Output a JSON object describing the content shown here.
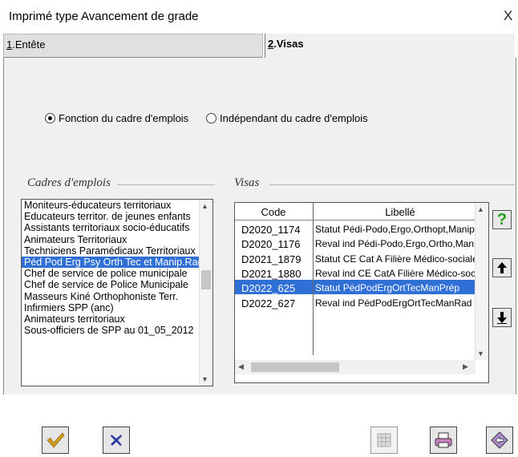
{
  "window": {
    "title": "Imprimé type Avancement de grade",
    "close_glyph": "X"
  },
  "tabs": [
    {
      "mnemonic": "1",
      "label": ".Entête"
    },
    {
      "mnemonic": "2",
      "label": ".Visas"
    }
  ],
  "options": {
    "fonction": "Fonction du cadre d'emplois",
    "independant": "Indépendant du cadre d'emplois",
    "selected": "fonction"
  },
  "cadres": {
    "label": "Cadres d'emplois",
    "items": [
      "Moniteurs-éducateurs territoriaux",
      "Educateurs territor. de jeunes enfants",
      "Assistants territoriaux socio-éducatifs",
      "Animateurs Territoriaux",
      "Techniciens Paramédicaux Territoriaux",
      "Péd Pod Erg Psy Orth Tec et Manip.Rad",
      "Chef de service de police municipale",
      "Chef de service de Police Municipale",
      "Masseurs Kiné Orthophoniste Terr.",
      "Infirmiers SPP (anc)",
      "Animateurs territoriaux",
      "Sous-officiers de SPP au 01_05_2012"
    ],
    "selected_index": 5
  },
  "visas": {
    "label": "Visas",
    "columns": {
      "code": "Code",
      "libelle": "Libellé"
    },
    "rows": [
      {
        "code": "D2020_1174",
        "libelle": "Statut Pédi-Podo,Ergo,Orthopt,Manip"
      },
      {
        "code": "D2020_1176",
        "libelle": "Reval ind Pédi-Podo,Ergo,Ortho,Manip"
      },
      {
        "code": "D2021_1879",
        "libelle": "Statut CE Cat A Filière Médico-sociale"
      },
      {
        "code": "D2021_1880",
        "libelle": "Reval ind CE CatA Filière Médico-soc"
      },
      {
        "code": "D2022_625",
        "libelle": "Statut PédPodErgOrtTecManPrép"
      },
      {
        "code": "D2022_627",
        "libelle": "Reval ind PédPodErgOrtTecManRad"
      }
    ],
    "selected_index": 4
  },
  "colors": {
    "selection": "#2f6fd6",
    "help": "#1e9c1e",
    "validate": "#d49a1c",
    "cancel": "#2a3a9c"
  },
  "icons": {
    "validate": "checkmark-icon",
    "cancel": "x-icon",
    "help": "question-mark-icon",
    "move_up": "arrow-up-icon",
    "move_down": "arrow-down-icon",
    "grid": "grid-icon",
    "print": "printer-icon",
    "back": "back-arrow-icon"
  }
}
